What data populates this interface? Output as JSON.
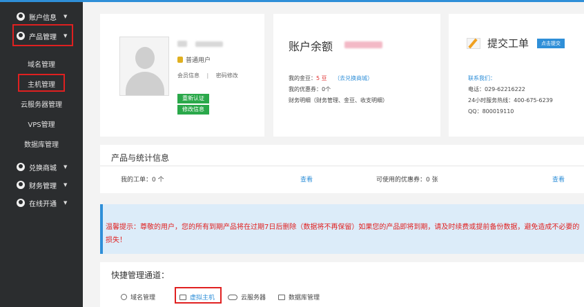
{
  "sidebar": {
    "account_info": "账户信息",
    "product_mgmt": "产品管理",
    "sub_items": [
      "域名管理",
      "主机管理",
      "云服务器管理",
      "VPS管理",
      "数据库管理"
    ],
    "exchange_mall": "兑换商城",
    "finance_mgmt": "财务管理",
    "online_open": "在线开通"
  },
  "profile": {
    "user_type": "普通用户",
    "member_info": "会员信息",
    "separator": "|",
    "change_password": "密码修改",
    "btn_green_1": "重新认证",
    "btn_green_2": "修改信息"
  },
  "balance": {
    "title": "账户余额",
    "gold_label": "我的金豆：",
    "gold_value": "5 豆",
    "mall_link": "（去兑换商城）",
    "coupon_label": "我的优惠券：",
    "coupon_value": "0个",
    "finance_line": "财务明细（财务管理、金豆、收支明细）"
  },
  "ticket": {
    "title": "提交工单",
    "submit_btn": "点击提交",
    "contact_head": "联系我们：",
    "phone": "电话：029-62216222",
    "hotline": "24小时服务热线：400-675-6239",
    "qq": "QQ：800019110"
  },
  "stats": {
    "title": "产品与统计信息",
    "my_tickets": "我的工单：0 个",
    "view1": "查看",
    "coupons": "可使用的优惠券：0 张",
    "view2": "查看"
  },
  "notice": {
    "text": "温馨提示：尊敬的用户，您的所有到期产品将在过期7日后删除（数据将不再保留）如果您的产品即将到期，请及时续费或提前备份数据，避免造成不必要的损失！"
  },
  "quick": {
    "title": "快捷管理通道：",
    "items": [
      "域名管理",
      "虚拟主机",
      "云服务器",
      "数据库管理"
    ]
  },
  "colors": {
    "sidebar_bg": "#2b2d2f",
    "accent_blue": "#2f8fd8",
    "notice_red": "#e02020",
    "notice_bg": "#dcecf9",
    "btn_green": "#2aa84a"
  }
}
